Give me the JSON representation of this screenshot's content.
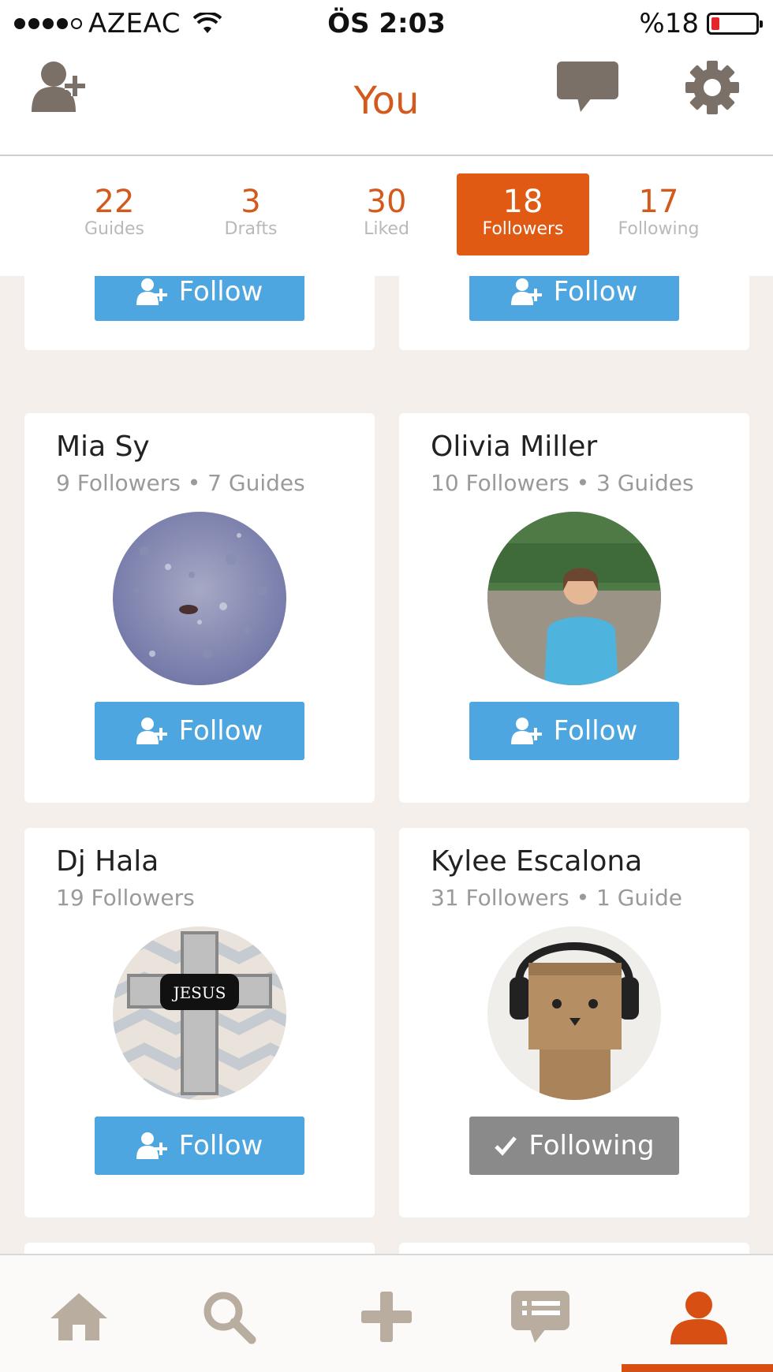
{
  "status_bar": {
    "carrier": "AZEAC",
    "time": "ÖS 2:03",
    "battery_percent": "%18",
    "battery_level": 0.18
  },
  "nav": {
    "title": "You",
    "left_icon": "add-user-icon",
    "right_icons": [
      "chat-bubble-icon",
      "gear-icon"
    ]
  },
  "stats": [
    {
      "count": "22",
      "label": "Guides",
      "active": false
    },
    {
      "count": "3",
      "label": "Drafts",
      "active": false
    },
    {
      "count": "30",
      "label": "Liked",
      "active": false
    },
    {
      "count": "18",
      "label": "Followers",
      "active": true
    },
    {
      "count": "17",
      "label": "Following",
      "active": false
    }
  ],
  "cards": [
    {
      "name": "",
      "meta": "",
      "button": "Follow",
      "state": "follow"
    },
    {
      "name": "",
      "meta": "",
      "button": "Follow",
      "state": "follow"
    },
    {
      "name": "Mia Sy",
      "meta": "9 Followers • 7 Guides",
      "button": "Follow",
      "state": "follow",
      "avatar": "gravel-photo"
    },
    {
      "name": "Olivia Miller",
      "meta": "10 Followers • 3 Guides",
      "button": "Follow",
      "state": "follow",
      "avatar": "girl-mountain-photo"
    },
    {
      "name": "Dj Hala",
      "meta": "19 Followers",
      "button": "Follow",
      "state": "follow",
      "avatar": "jesus-cross-image",
      "avatar_text": "JESUS"
    },
    {
      "name": "Kylee Escalona",
      "meta": "31 Followers • 1 Guide",
      "button": "Following",
      "state": "following",
      "avatar": "box-robot-headphones-photo"
    }
  ],
  "tabs": [
    "home-icon",
    "search-icon",
    "plus-icon",
    "messages-icon",
    "profile-icon"
  ],
  "active_tab": "profile-icon",
  "colors": {
    "accent": "#e05a14",
    "follow_blue": "#4ea6e0",
    "following_gray": "#8a8a8a",
    "icon_gray": "#7a7068"
  }
}
